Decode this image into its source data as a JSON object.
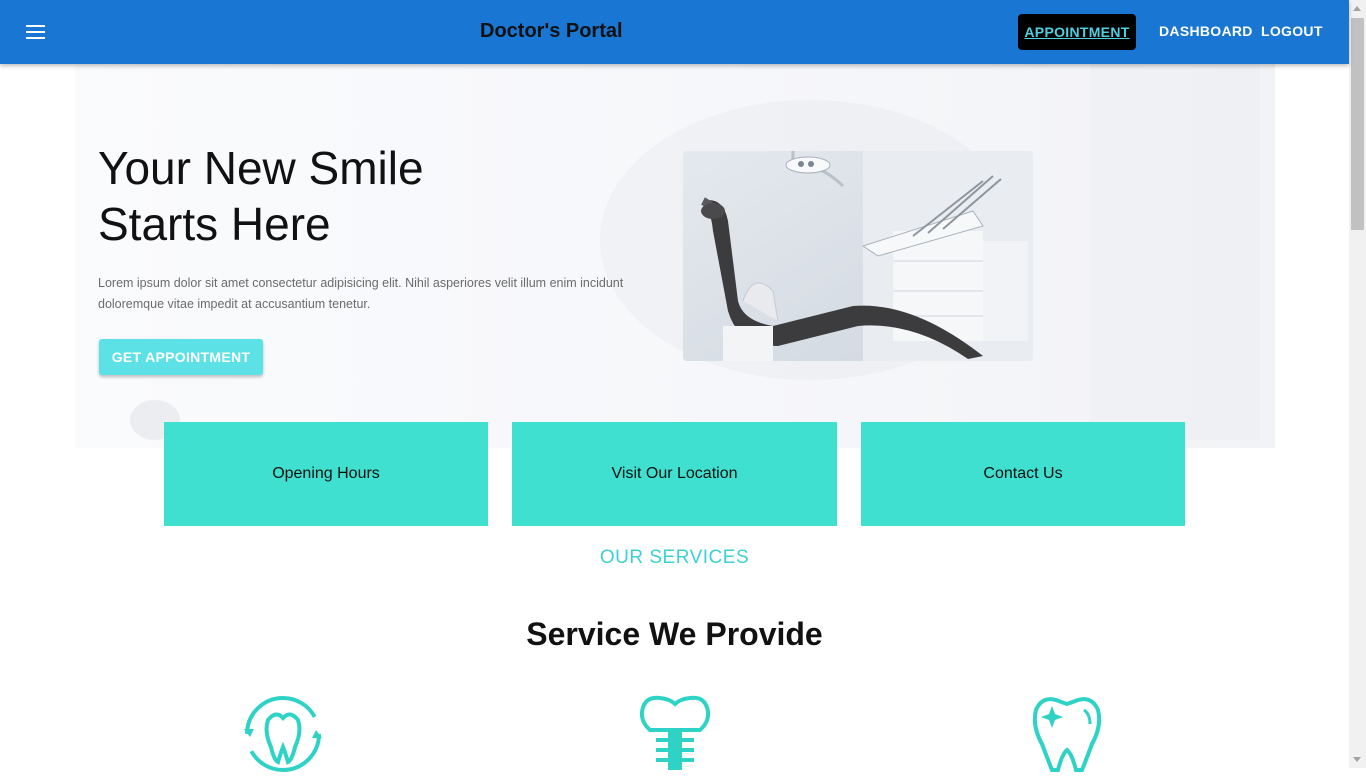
{
  "header": {
    "title": "Doctor's Portal",
    "nav": {
      "appointment": "APPOINTMENT",
      "dashboard": "DASHBOARD",
      "logout": "LOGOUT"
    },
    "icon": "menu-icon"
  },
  "hero": {
    "title_line1": "Your New Smile",
    "title_line2": "Starts Here",
    "description_line1": "Lorem ipsum dolor sit amet consectetur adipisicing elit. Nihil asperiores velit illum enim incidunt",
    "description_line2": "doloremque vitae impedit at accusantium tenetur.",
    "cta": "GET APPOINTMENT",
    "image": "dental-chair-image"
  },
  "info_cards": [
    {
      "label": "Opening Hours"
    },
    {
      "label": "Visit Our Location"
    },
    {
      "label": "Contact Us"
    }
  ],
  "services": {
    "eyebrow": "OUR SERVICES",
    "title": "Service We Provide",
    "icons": [
      "tooth-cycle-icon",
      "dental-implant-icon",
      "sparkle-tooth-icon"
    ]
  },
  "colors": {
    "appbar": "#1976d2",
    "accent_teal": "#3fe0d0",
    "cta": "#5ce1e6",
    "services_label": "#3ed1d3",
    "nav_highlight_bg": "#000000",
    "nav_highlight_text": "#4dd0e1"
  }
}
